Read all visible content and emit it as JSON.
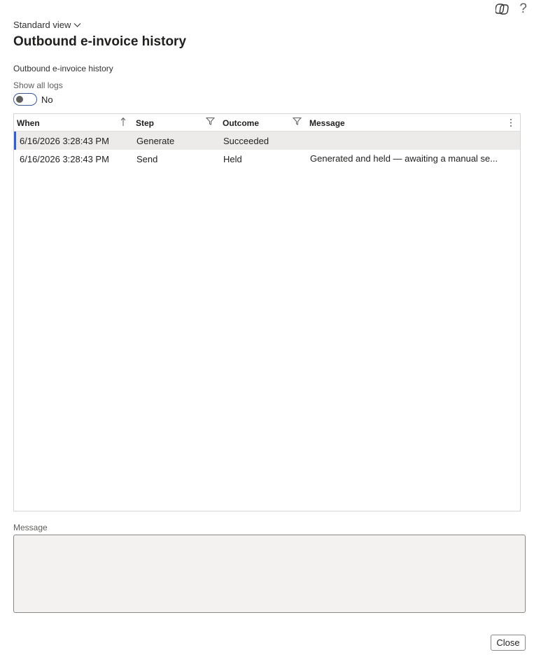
{
  "header": {
    "view_selector": "Standard view",
    "title": "Outbound e-invoice history",
    "icons": [
      "copilot-icon",
      "help-icon"
    ],
    "help_glyph": "?"
  },
  "section": {
    "label": "Outbound e-invoice history"
  },
  "toggle": {
    "label": "Show all logs",
    "value": "No",
    "on": false
  },
  "grid": {
    "columns": [
      "When",
      "Step",
      "Outcome",
      "Message"
    ],
    "rows": [
      {
        "when": "6/16/2026 3:28:43 PM",
        "step": "Generate",
        "outcome": "Succeeded",
        "message": "",
        "selected": true
      },
      {
        "when": "6/16/2026 3:28:43 PM",
        "step": "Send",
        "outcome": "Held",
        "message": "Generated and held — awaiting a manual se...",
        "selected": false
      }
    ]
  },
  "message_panel": {
    "label": "Message",
    "value": ""
  },
  "footer": {
    "close_label": "Close"
  },
  "colors": {
    "accent": "#3b5fc0",
    "toggle_border": "#3b5896",
    "selected_row": "#edebe9"
  }
}
